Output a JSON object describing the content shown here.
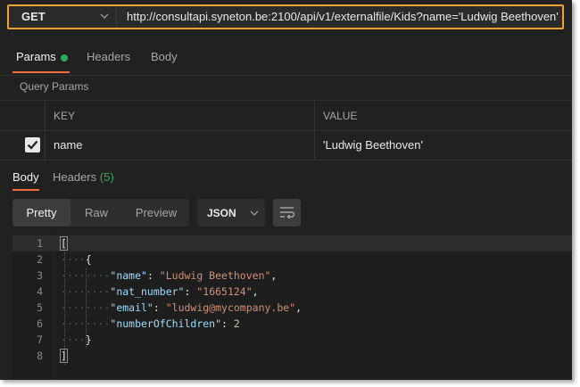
{
  "request": {
    "method": "GET",
    "url": "http://consultapi.syneton.be:2100/api/v1/externalfile/Kids?name='Ludwig Beethoven'"
  },
  "request_tabs": [
    "Params",
    "Headers",
    "Body"
  ],
  "query_params": {
    "title": "Query Params",
    "columns": [
      "KEY",
      "VALUE"
    ],
    "rows": [
      {
        "checked": true,
        "key": "name",
        "value": "'Ludwig Beethoven'"
      }
    ]
  },
  "response": {
    "tabs": [
      {
        "label": "Body"
      },
      {
        "label": "Headers",
        "count": "(5)"
      }
    ],
    "view_modes": [
      "Pretty",
      "Raw",
      "Preview"
    ],
    "active_view": "Pretty",
    "format": "JSON",
    "lines": [
      {
        "n": "1",
        "text": "["
      },
      {
        "n": "2",
        "text": "{"
      },
      {
        "n": "3",
        "key": "\"name\"",
        "value": "\"Ludwig Beethoven\"",
        "type": "str",
        "comma": ","
      },
      {
        "n": "4",
        "key": "\"nat_number\"",
        "value": "\"1665124\"",
        "type": "str",
        "comma": ","
      },
      {
        "n": "5",
        "key": "\"email\"",
        "value": "\"ludwig@mycompany.be\"",
        "type": "str",
        "comma": ","
      },
      {
        "n": "6",
        "key": "\"numberOfChildren\"",
        "value": "2",
        "type": "num",
        "comma": ""
      },
      {
        "n": "7",
        "text": "}"
      },
      {
        "n": "8",
        "text": "]"
      }
    ]
  },
  "colors": {
    "accent": "#f26b3a",
    "highlight_border": "#f0a135",
    "success": "#27ae60"
  }
}
